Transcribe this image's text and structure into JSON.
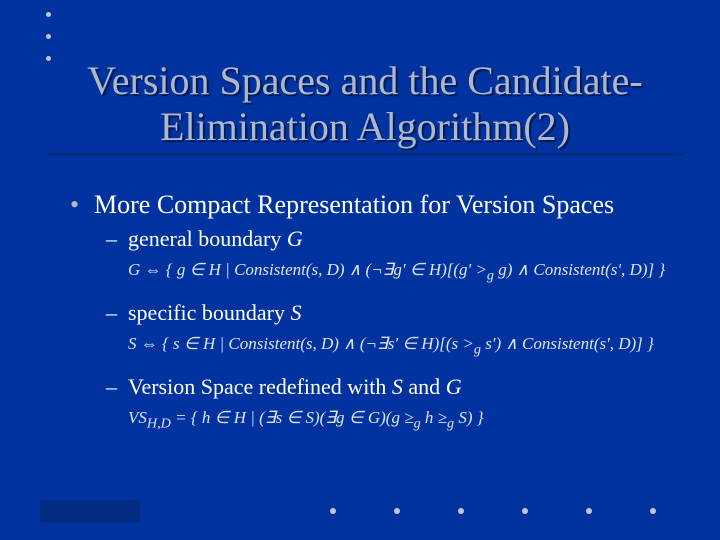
{
  "title": "Version Spaces and the Candidate-Elimination Algorithm(2)",
  "bullets": {
    "top": "More Compact Representation for Version Spaces",
    "sub1": "general boundary ",
    "sub1_ital": "G",
    "formula1": "G ⇔ { g ∈ H | Consistent(s, D) ∧ (¬∃g' ∈ H)[(g' >g g) ∧ Consistent(s', D)] }",
    "sub2": "specific boundary ",
    "sub2_ital": "S",
    "formula2": "S ⇔ { s ∈ H | Consistent(s, D) ∧ (¬∃s' ∈ H)[(s >g s') ∧ Consistent(s', D)] }",
    "sub3_a": "Version Space redefined with ",
    "sub3_b": "S",
    "sub3_c": " and ",
    "sub3_d": "G",
    "formula3": "VS_{H,D} = { h ∈ H | (∃s ∈ S)(∃g ∈ G)(g ≥g h ≥g S) }"
  }
}
